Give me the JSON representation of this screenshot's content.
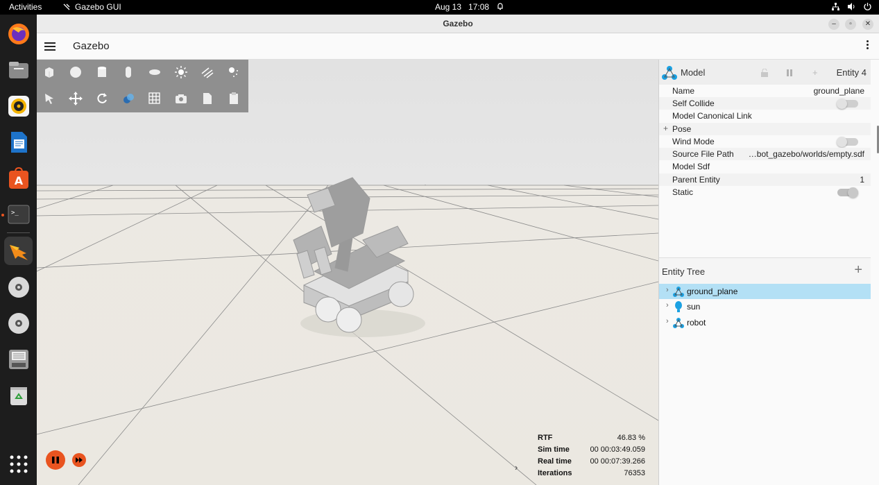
{
  "topbar": {
    "activities": "Activities",
    "app_name": "Gazebo GUI",
    "date": "Aug 13",
    "time": "17:08"
  },
  "dock": {
    "apps": [
      "firefox-icon",
      "files-icon",
      "rhythmbox-icon",
      "writer-icon",
      "app-center-icon",
      "terminal-icon",
      "gazebo-icon",
      "disc-icon",
      "disc-icon",
      "disk-icon",
      "trash-icon",
      "show-apps-icon"
    ]
  },
  "window": {
    "title": "Gazebo"
  },
  "appbar": {
    "title": "Gazebo"
  },
  "toolbar": {
    "row1": [
      "box-shape-icon",
      "sphere-shape-icon",
      "cylinder-shape-icon",
      "capsule-shape-icon",
      "ellipsoid-shape-icon",
      "point-light-icon",
      "directional-light-icon",
      "spot-light-icon"
    ],
    "row2": [
      "select-tool-icon",
      "translate-tool-icon",
      "rotate-tool-icon",
      "transform-control-icon",
      "grid-icon",
      "screenshot-icon",
      "copy-icon",
      "paste-icon"
    ]
  },
  "stats": {
    "rtf_label": "RTF",
    "rtf_value": "46.83 %",
    "sim_label": "Sim time",
    "sim_value": "00 00:03:49.059",
    "real_label": "Real time",
    "real_value": "00 00:07:39.266",
    "iter_label": "Iterations",
    "iter_value": "76353"
  },
  "component_inspector": {
    "type": "Model",
    "entity": "Entity 4",
    "rows": [
      {
        "label": "Name",
        "value": "ground_plane"
      },
      {
        "label": "Self Collide",
        "value": ""
      },
      {
        "label": "Model Canonical Link",
        "value": ""
      },
      {
        "label": "Pose",
        "value": ""
      },
      {
        "label": "Wind Mode",
        "value": ""
      },
      {
        "label": "Source File Path",
        "value": "…bot_gazebo/worlds/empty.sdf"
      },
      {
        "label": "Model Sdf",
        "value": ""
      },
      {
        "label": "Parent Entity",
        "value": "1"
      },
      {
        "label": "Static",
        "value": ""
      }
    ],
    "pose_prefix": "+"
  },
  "entity_tree": {
    "title": "Entity Tree",
    "add_label": "+",
    "items": [
      {
        "name": "ground_plane",
        "icon": "model-icon",
        "selected": true
      },
      {
        "name": "sun",
        "icon": "light-bulb-icon",
        "selected": false
      },
      {
        "name": "robot",
        "icon": "model-icon",
        "selected": false
      }
    ]
  },
  "colors": {
    "accent": "#e95420",
    "selection": "#b3e0f5",
    "model_icon": "#1ba1e2",
    "toolbar_bg": "#8f8f8f"
  }
}
